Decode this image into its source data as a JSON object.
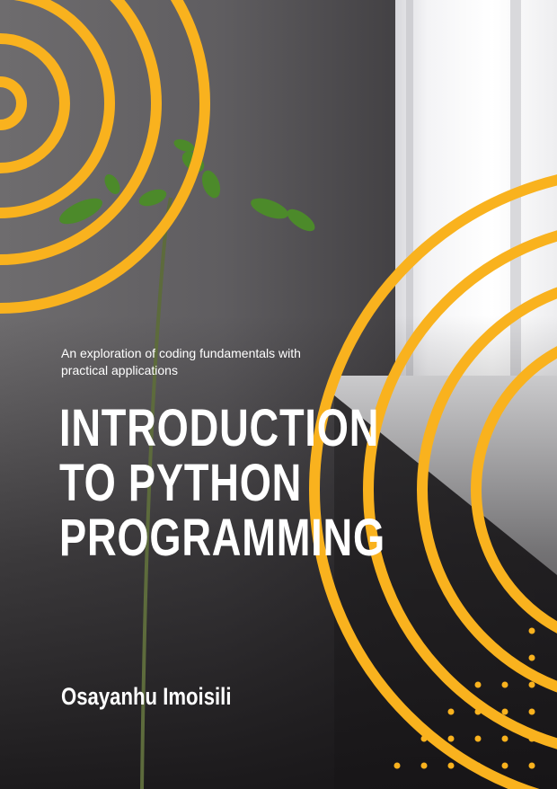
{
  "cover": {
    "subtitle": "An exploration of coding fundamentals with practical applications",
    "title_lines": [
      "INTRODUCTION",
      "TO PYTHON",
      "PROGRAMMING"
    ],
    "author": "Osayanhu Imoisili"
  },
  "colors": {
    "accent": "#f9b21e",
    "wall": "#5f5d60",
    "text": "#ffffff"
  }
}
